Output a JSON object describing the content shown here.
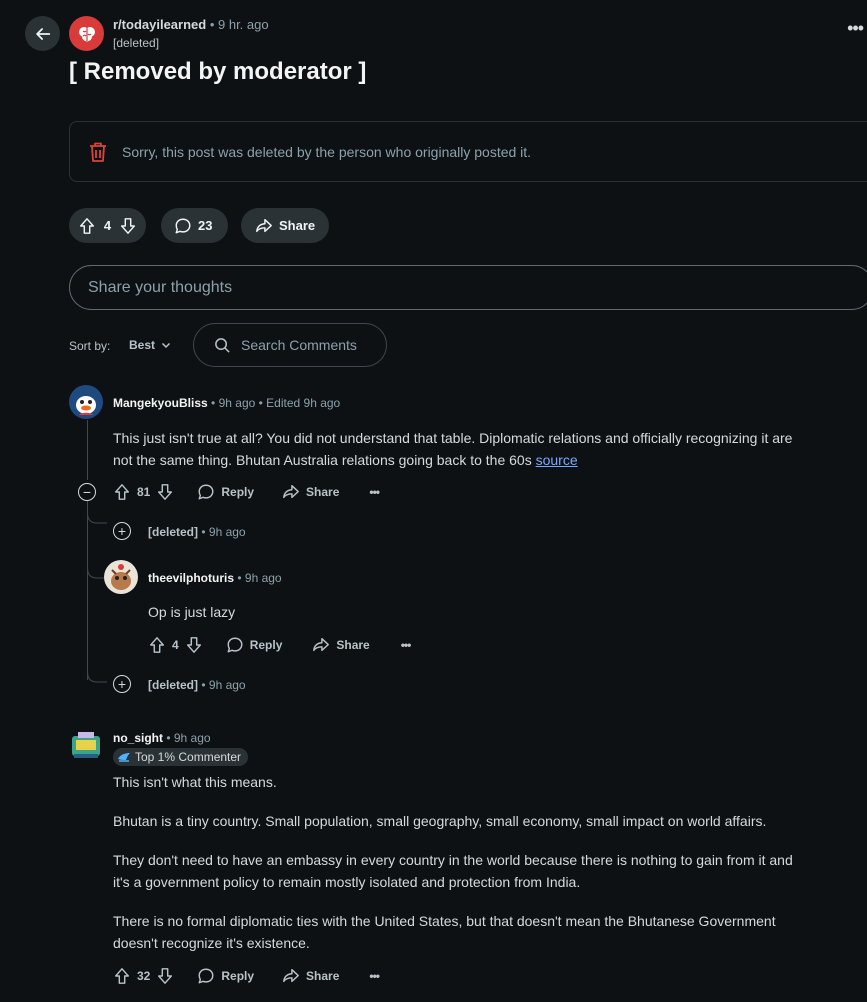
{
  "header": {
    "subreddit": "r/todayilearned",
    "time": "• 9 hr. ago",
    "author": "[deleted]",
    "more": "•••"
  },
  "post": {
    "title": "[ Removed by moderator ]",
    "deleted_notice": "Sorry, this post was deleted by the person who originally posted it.",
    "votes": "4",
    "comments": "23",
    "share_label": "Share"
  },
  "composer": {
    "placeholder": "Share your thoughts"
  },
  "sort": {
    "label": "Sort by:",
    "value": "Best",
    "search_placeholder": "Search Comments"
  },
  "comments": [
    {
      "user": "MangekyouBliss",
      "meta": " • 9h ago • Edited 9h ago",
      "body_lines": [
        "This just isn't true at all? You did not understand that table. Diplomatic relations and officially recognizing it are",
        "not the same thing. Bhutan Australia relations going back to the 60s "
      ],
      "link": "source",
      "votes": "81",
      "reply": "Reply",
      "share": "Share",
      "more": "•••"
    },
    {
      "user": "[deleted]",
      "meta": " • 9h ago"
    },
    {
      "user": "theevilphoturis",
      "meta": " • 9h ago",
      "body": "Op is just lazy",
      "votes": "4",
      "reply": "Reply",
      "share": "Share",
      "more": "•••"
    },
    {
      "user": "[deleted]",
      "meta": " • 9h ago"
    },
    {
      "user": "no_sight",
      "meta": " • 9h ago",
      "flair": "Top 1% Commenter",
      "paragraphs": [
        "This isn't what this means.",
        "Bhutan is a tiny country. Small population, small geography, small economy, small impact on world affairs.",
        "They don't need to have an embassy in every country in the world because there is nothing to gain from it and",
        "it's a government policy to remain mostly isolated and protection from India.",
        "There is no formal diplomatic ties with the United States, but that doesn't mean the Bhutanese Government",
        "doesn't recognize it's existence."
      ],
      "votes": "32",
      "reply": "Reply",
      "share": "Share",
      "more": "•••"
    }
  ],
  "colors": {
    "background": "#0e1113",
    "pill": "#2a3236",
    "delete_red": "#e0403a",
    "link": "#7aa7ff"
  }
}
